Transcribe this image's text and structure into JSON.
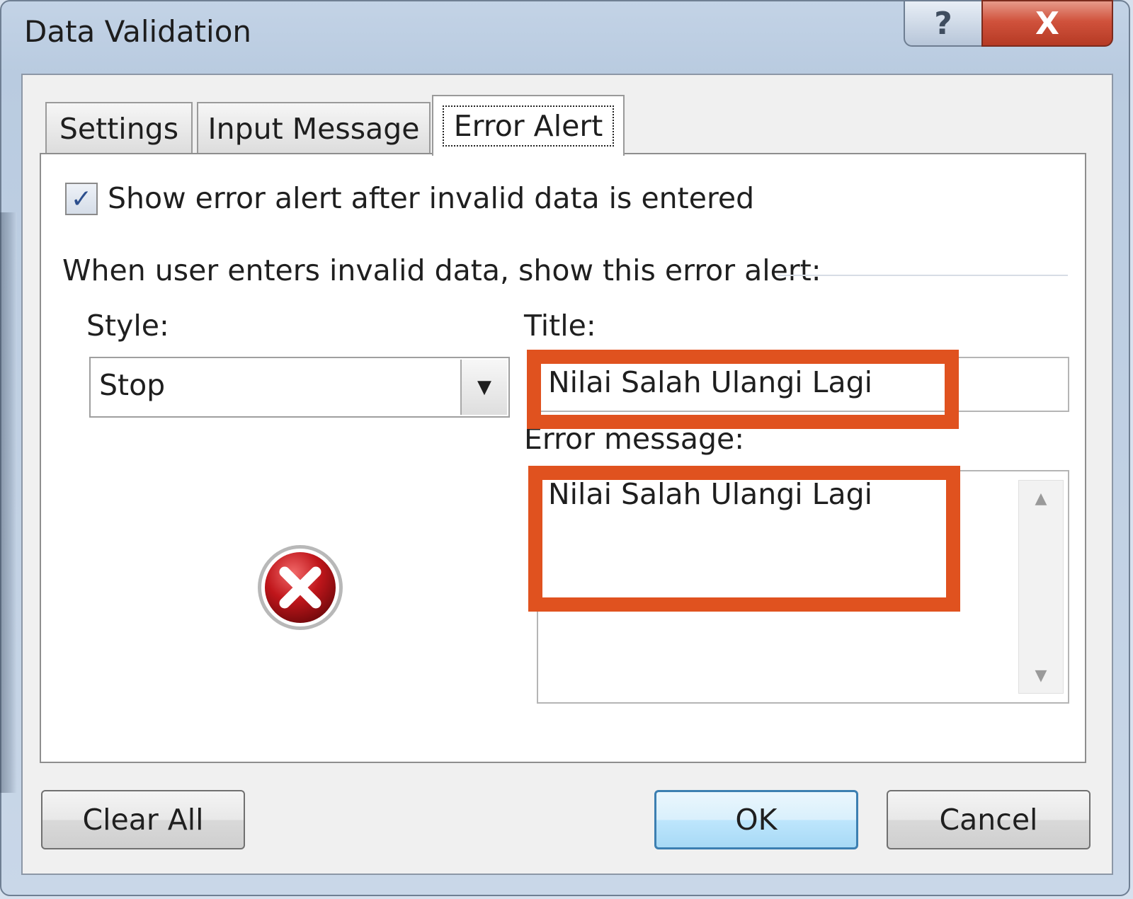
{
  "window": {
    "title": "Data Validation",
    "help_glyph": "?",
    "close_glyph": "X"
  },
  "tabs": [
    {
      "label": "Settings"
    },
    {
      "label": "Input Message"
    },
    {
      "label": "Error Alert",
      "active": true
    }
  ],
  "error_alert": {
    "show_alert_label": "Show error alert after invalid data is entered",
    "show_alert_checked": true,
    "group_label": "When user enters invalid data, show this error alert:",
    "style_label": "Style:",
    "style_value": "Stop",
    "title_label": "Title:",
    "title_value": "Nilai Salah Ulangi Lagi",
    "message_label": "Error message:",
    "message_value": "Nilai Salah Ulangi Lagi",
    "style_icon": "stop-icon"
  },
  "buttons": {
    "clear_all": "Clear All",
    "ok": "OK",
    "cancel": "Cancel"
  },
  "colors": {
    "highlight": "#e0521f",
    "accent_button_border": "#3c7fb1",
    "stop_icon": "#c0161b"
  }
}
